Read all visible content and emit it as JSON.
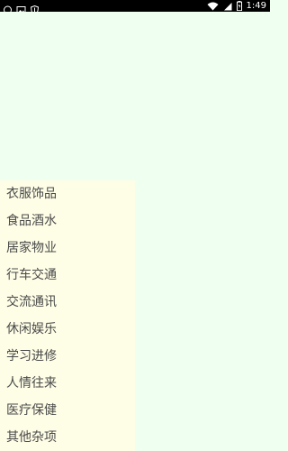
{
  "status_bar": {
    "time": "1:49",
    "icons": [
      "whatsapp-icon",
      "image-icon",
      "shield-icon",
      "wifi-icon",
      "signal-icon",
      "battery-icon"
    ]
  },
  "menu": {
    "items": [
      {
        "label": "衣服饰品"
      },
      {
        "label": "食品酒水"
      },
      {
        "label": "居家物业"
      },
      {
        "label": "行车交通"
      },
      {
        "label": "交流通讯"
      },
      {
        "label": "休闲娱乐"
      },
      {
        "label": "学习进修"
      },
      {
        "label": "人情往来"
      },
      {
        "label": "医疗保健"
      },
      {
        "label": "其他杂项"
      }
    ]
  },
  "colors": {
    "background": "#effff0",
    "menu_background": "#fefde6",
    "status_bar": "#000000",
    "menu_text": "#4a4a4a"
  }
}
